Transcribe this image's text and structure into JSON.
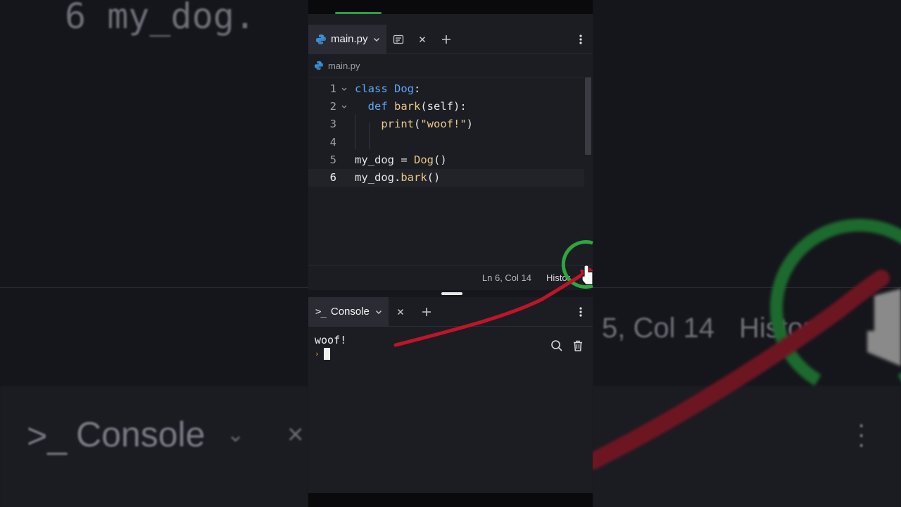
{
  "editor_tab": {
    "filename": "main.py"
  },
  "breadcrumb": {
    "filename": "main.py"
  },
  "code": {
    "lines": [
      {
        "num": "1",
        "tokens": [
          {
            "t": "class ",
            "c": "kw"
          },
          {
            "t": "Dog",
            "c": "cls"
          },
          {
            "t": ":",
            "c": "plain"
          }
        ]
      },
      {
        "num": "2",
        "tokens": [
          {
            "t": "  ",
            "c": "plain"
          },
          {
            "t": "def ",
            "c": "kw"
          },
          {
            "t": "bark",
            "c": "fn"
          },
          {
            "t": "(self):",
            "c": "plain"
          }
        ]
      },
      {
        "num": "3",
        "tokens": [
          {
            "t": "    ",
            "c": "plain"
          },
          {
            "t": "print",
            "c": "fn"
          },
          {
            "t": "(",
            "c": "plain"
          },
          {
            "t": "\"woof!\"",
            "c": "str"
          },
          {
            "t": ")",
            "c": "plain"
          }
        ]
      },
      {
        "num": "4",
        "tokens": []
      },
      {
        "num": "5",
        "tokens": [
          {
            "t": "my_dog = ",
            "c": "plain"
          },
          {
            "t": "Dog",
            "c": "fn"
          },
          {
            "t": "()",
            "c": "plain"
          }
        ]
      },
      {
        "num": "6",
        "tokens": [
          {
            "t": "my_dog.",
            "c": "plain"
          },
          {
            "t": "bark",
            "c": "fn"
          },
          {
            "t": "()",
            "c": "plain"
          }
        ]
      }
    ]
  },
  "status": {
    "position": "Ln 6, Col 14",
    "history": "Histor"
  },
  "console_tab": {
    "label": "Console"
  },
  "console": {
    "output": "woof!",
    "prompt": "›"
  },
  "background": {
    "code_fragment": "6   my_dog.",
    "position_fragment": "5, Col 14",
    "history_fragment": "Histor",
    "console_label": "Console"
  },
  "colors": {
    "accent_green": "#2e9d48",
    "annotation_red": "#c0142a",
    "keyword": "#5fa8f5",
    "string": "#e9c98a"
  }
}
